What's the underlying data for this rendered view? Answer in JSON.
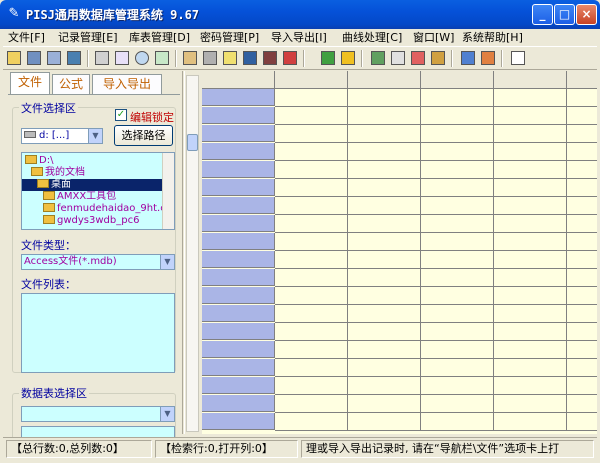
{
  "window": {
    "title": "PISJ通用数据库管理系统 9.67",
    "minimize": "_",
    "maximize": "□",
    "close": "×"
  },
  "menu": [
    "文件[F]",
    "记录管理[E]",
    "库表管理[D]",
    "密码管理[P]",
    "导入导出[I]",
    "曲线处理[C]",
    "窗口[W]",
    "系统帮助[H]"
  ],
  "left_tabs": [
    "文件",
    "公式",
    "导入导出"
  ],
  "file_select": {
    "group_label": "文件选择区",
    "lock_label": "编辑锁定",
    "lock_checked": "✓",
    "drive_value": "d: [...]",
    "path_button": "选择路径",
    "tree": [
      "D:\\",
      "我的文档",
      "桌面",
      "AMXX工具包",
      "fenmudehaidao_9ht.c",
      "gwdys3wdb_pc6"
    ],
    "file_type_label": "文件类型：",
    "file_type_value": "Access文件(*.mdb)",
    "file_list_label": "文件列表："
  },
  "table_select": {
    "group_label": "数据表选择区"
  },
  "status": {
    "totals": "【总行数:0,总列数:0】",
    "cursor": "【检索行:0,打开列:0】",
    "hint": "理或导入导出记录时, 请在“导航栏\\文件”选项卡上打"
  }
}
